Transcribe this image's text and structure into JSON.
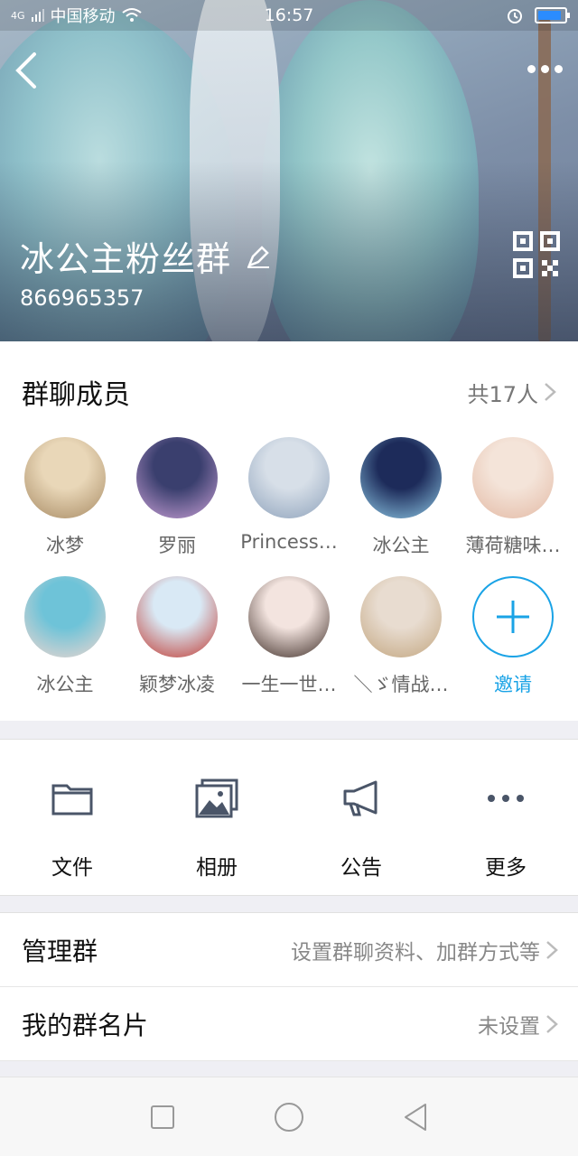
{
  "status_bar": {
    "network": "4G",
    "carrier": "中国移动",
    "time": "16:57",
    "battery_level": 0.9,
    "battery_color": "#2b8cff"
  },
  "header": {
    "back_icon": "chevron-left-icon",
    "more_icon": "ellipsis-icon",
    "group_name": "冰公主粉丝群",
    "group_id": "866965357",
    "edit_icon": "pencil-icon",
    "qr_icon": "qr-code-icon"
  },
  "members": {
    "title": "群聊成员",
    "count": "共17人",
    "items": [
      {
        "name": "冰梦",
        "avatar_colors": [
          "#e9d7b8",
          "#a78a63"
        ]
      },
      {
        "name": "罗丽",
        "avatar_colors": [
          "#3a3f6e",
          "#c9a0d6"
        ]
      },
      {
        "name": "Princess…",
        "avatar_colors": [
          "#d7dfe8",
          "#8ea2bb"
        ]
      },
      {
        "name": "冰公主",
        "avatar_colors": [
          "#1d2b5a",
          "#8fc9e6"
        ]
      },
      {
        "name": "薄荷糖味…",
        "avatar_colors": [
          "#f4e4d9",
          "#e3b9a4"
        ]
      },
      {
        "name": "冰公主",
        "avatar_colors": [
          "#6ec3d8",
          "#f0d6cf"
        ]
      },
      {
        "name": "颖梦冰凌",
        "avatar_colors": [
          "#d9e9f5",
          "#c0372f"
        ]
      },
      {
        "name": "一生一世…",
        "avatar_colors": [
          "#f3e4df",
          "#3b2a24"
        ]
      },
      {
        "name": "＼ゞ情战…",
        "avatar_colors": [
          "#e8dcd0",
          "#c2a57e"
        ]
      }
    ],
    "invite_label": "邀请",
    "accent": "#1aa3e6"
  },
  "functions": [
    {
      "label": "文件",
      "icon": "folder-icon"
    },
    {
      "label": "相册",
      "icon": "photo-album-icon"
    },
    {
      "label": "公告",
      "icon": "megaphone-icon"
    },
    {
      "label": "更多",
      "icon": "more-dots-icon"
    }
  ],
  "settings": [
    {
      "title": "管理群",
      "value": "设置群聊资料、加群方式等"
    },
    {
      "title": "我的群名片",
      "value": "未设置"
    }
  ],
  "nav": {
    "recent_icon": "square-icon",
    "home_icon": "circle-icon",
    "back_icon": "triangle-back-icon"
  }
}
